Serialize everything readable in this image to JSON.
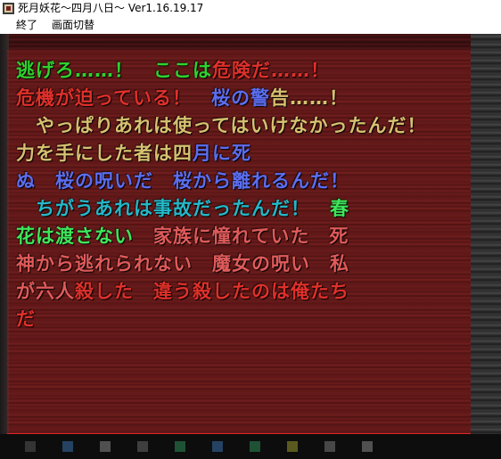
{
  "window": {
    "title": "死月妖花～四月八日～ Ver1.16.19.17"
  },
  "menu": {
    "items": [
      {
        "label": "終了"
      },
      {
        "label": "画面切替"
      }
    ]
  },
  "message": {
    "segments": [
      {
        "text": "逃げろ……！　",
        "color": "green"
      },
      {
        "text": "ここは",
        "color": "green"
      },
      {
        "text": "危険",
        "color": "red"
      },
      {
        "text": "だ……！",
        "color": "red"
      },
      {
        "text": "\n危機が迫っている！　",
        "color": "red"
      },
      {
        "text": "桜の警",
        "color": "blue"
      },
      {
        "text": "告……！",
        "color": "gold"
      },
      {
        "text": "\n　やっぱりあれは使ってはいけなかったんだ！　力を手にした者は四",
        "color": "gold"
      },
      {
        "text": "月に死",
        "color": "blue"
      },
      {
        "text": "\nぬ　桜の呪いだ　桜から離れるんだ！",
        "color": "blue"
      },
      {
        "text": "\n　ちがうあれは事故だったんだ！　",
        "color": "cyan"
      },
      {
        "text": "春",
        "color": "lime"
      },
      {
        "text": "\n花は渡さない　",
        "color": "lime"
      },
      {
        "text": "家族に憧れていた　死",
        "color": "pink"
      },
      {
        "text": "\n神から逃れられない　魔女の呪い　私",
        "color": "pink"
      },
      {
        "text": "\nが六人",
        "color": "pink"
      },
      {
        "text": "殺した　違う殺したのは俺たち",
        "color": "red"
      },
      {
        "text": "\nだ",
        "color": "red"
      }
    ]
  },
  "colors": {
    "green": "#2fd22f",
    "red": "#e0302a",
    "blue": "#5b6ef0",
    "gold": "#d7c070",
    "cyan": "#24b8c8",
    "lime": "#3ee65a",
    "pink": "#e05a5a",
    "accent_bar": "#e02424"
  },
  "bottom_icons": [
    {
      "icon": "save-icon"
    },
    {
      "icon": "load-icon"
    },
    {
      "icon": "log-icon"
    },
    {
      "icon": "auto-icon"
    },
    {
      "icon": "skip-icon"
    },
    {
      "icon": "config-icon"
    },
    {
      "icon": "hide-icon"
    },
    {
      "icon": "screen-icon"
    },
    {
      "icon": "title-icon"
    },
    {
      "icon": "exit-icon"
    }
  ]
}
